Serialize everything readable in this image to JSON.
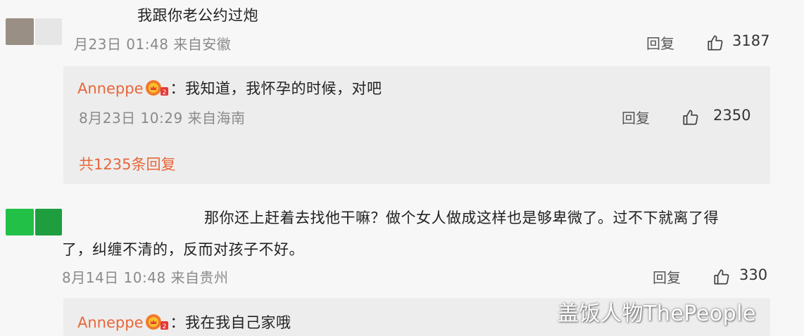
{
  "comments": [
    {
      "text": "我跟你老公约过炮",
      "meta": "月23日 01:48 来自安徽",
      "reply_label": "回复",
      "likes": "3187",
      "avatar_colors": [
        "#9a8f85",
        "#e6e6e6"
      ],
      "sub_reply": {
        "username": "Anneppe",
        "separator": "：",
        "text": "我知道，我怀孕的时候，对吧",
        "meta": "8月23日 10:29 来自海南",
        "reply_label": "回复",
        "likes": "2350"
      },
      "total_replies": "共1235条回复"
    },
    {
      "text_line1": "那你还上赶着去找他干嘛？做个女人做成这样也是够卑微了。过不下就离了得",
      "text_line2": "了，纠缠不清的，反而对孩子不好。",
      "meta": "8月14日 10:48 来自贵州",
      "reply_label": "回复",
      "likes": "330",
      "avatar_colors": [
        "#22c046",
        "#1e9e3e"
      ],
      "sub_reply": {
        "username": "Anneppe",
        "separator": "：",
        "text": "我在我自己家哦"
      }
    }
  ],
  "watermark": "盖饭人物ThePeople",
  "colors": {
    "accent": "#e8673a",
    "background": "#f7f7f7",
    "sub_background": "#ededed",
    "meta_text": "#8a8a8a"
  },
  "icons": {
    "like": "thumbs-up-icon",
    "badge": "member-badge-icon"
  }
}
